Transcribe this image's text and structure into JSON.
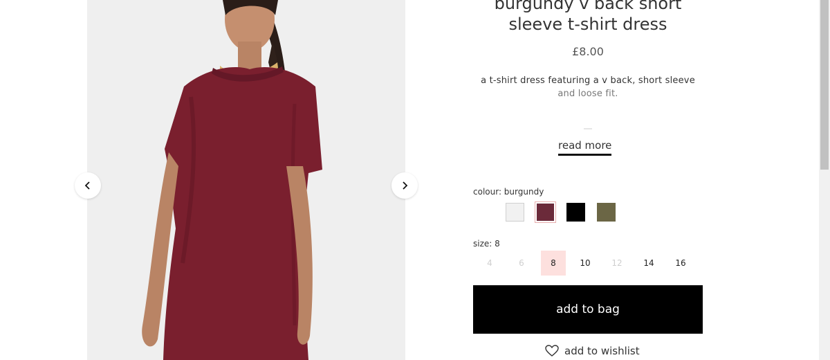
{
  "product": {
    "title": "burgundy v back short sleeve t-shirt dress",
    "price": "£8.00",
    "description_line1": "a t-shirt dress featuring a v back, short sleeve",
    "description_line2": "and loose fit.",
    "read_more": "read more"
  },
  "gallery": {
    "prev_icon": "chevron-left-icon",
    "next_icon": "chevron-right-icon"
  },
  "colour": {
    "label": "colour: burgundy",
    "options": [
      {
        "color": "#f1f1f1",
        "selected": false
      },
      {
        "color": "#6b2a3a",
        "selected": true
      },
      {
        "color": "#000000",
        "selected": false
      },
      {
        "color": "#6b6645",
        "selected": false
      }
    ]
  },
  "size": {
    "label": "size: 8",
    "options": [
      {
        "label": "4",
        "available": false,
        "selected": false
      },
      {
        "label": "6",
        "available": false,
        "selected": false
      },
      {
        "label": "8",
        "available": true,
        "selected": true
      },
      {
        "label": "10",
        "available": true,
        "selected": false
      },
      {
        "label": "12",
        "available": false,
        "selected": false
      },
      {
        "label": "14",
        "available": true,
        "selected": false
      },
      {
        "label": "16",
        "available": true,
        "selected": false
      }
    ]
  },
  "actions": {
    "add_to_bag": "add to bag",
    "add_to_wishlist": "add to wishlist",
    "wishlist_icon": "heart-icon"
  },
  "colors": {
    "dress": "#7a1f2e",
    "selected_size_bg": "#fde0de",
    "button_bg": "#000000"
  }
}
